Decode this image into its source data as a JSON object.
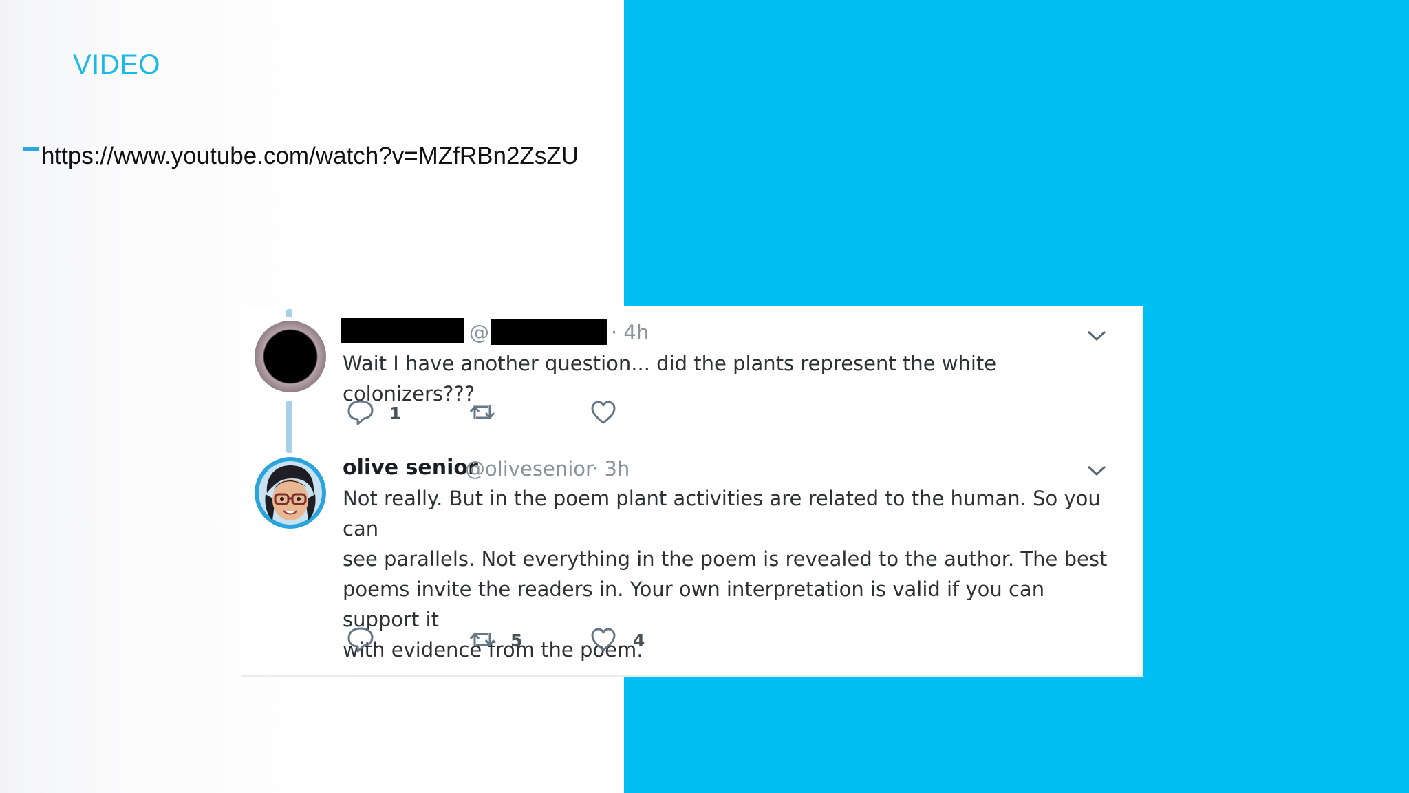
{
  "slide": {
    "title": "VIDEO",
    "link": "https://www.youtube.com/watch?v=MZfRBn2ZsZU",
    "accent_color": "#00bff2",
    "title_color": "#19b9e9"
  },
  "thread": {
    "tweets": [
      {
        "display_name": "",
        "at_symbol": "@",
        "time": "· 4h",
        "text": "Wait I have another question... did the plants represent the white colonizers???",
        "reply_count": "1",
        "retweet_count": "",
        "like_count": ""
      },
      {
        "display_name": "olive senior",
        "handle": "@olivesenior",
        "time": "· 3h",
        "text_lines": [
          "Not really. But in the poem plant activities are related to the human. So you can",
          "see parallels. Not everything in the poem is revealed to the author. The best",
          "poems invite the readers in. Your own interpretation is valid if you can support it",
          "with evidence from the poem."
        ],
        "reply_count": "",
        "retweet_count": "5",
        "like_count": "4"
      }
    ]
  },
  "icons": {
    "reply": "speech-bubble-icon",
    "retweet": "retweet-arrows-icon",
    "like": "heart-icon",
    "more": "chevron-down-icon"
  }
}
